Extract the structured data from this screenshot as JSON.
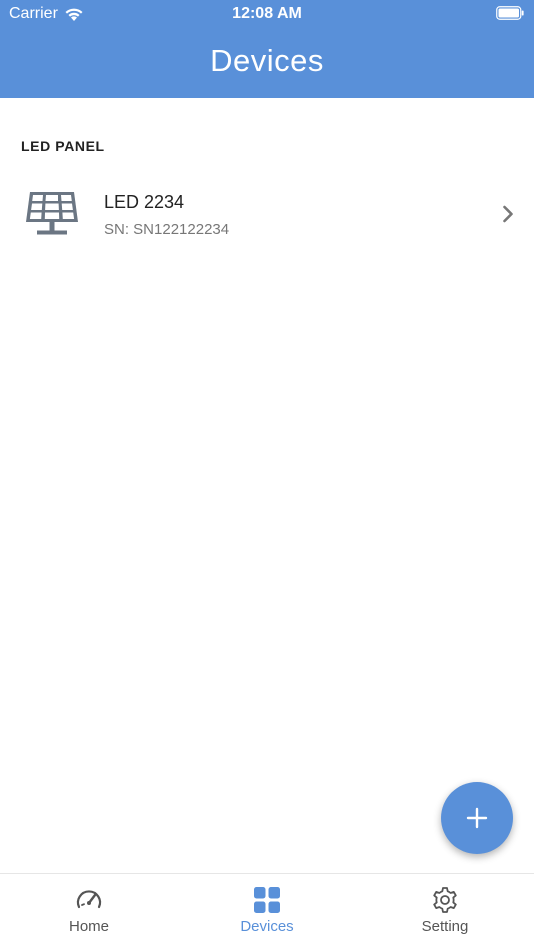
{
  "status_bar": {
    "carrier": "Carrier",
    "time": "12:08 AM"
  },
  "header": {
    "title": "Devices"
  },
  "section": {
    "title": "LED PANEL"
  },
  "devices": [
    {
      "name": "LED 2234",
      "sn": "SN: SN122122234",
      "icon": "solar-panel-icon"
    }
  ],
  "tabs": [
    {
      "label": "Home",
      "icon": "speedometer-icon",
      "active": false
    },
    {
      "label": "Devices",
      "icon": "grid-icon",
      "active": true
    },
    {
      "label": "Setting",
      "icon": "gear-icon",
      "active": false
    }
  ],
  "colors": {
    "primary": "#5990d9",
    "text": "#222222",
    "muted": "#777777",
    "icon_gray": "#6b7683"
  }
}
